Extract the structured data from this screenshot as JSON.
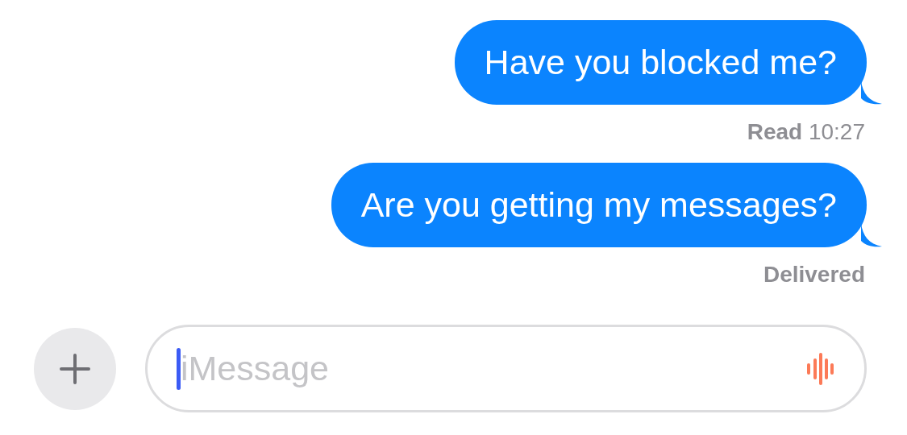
{
  "messages": [
    {
      "text": "Have you blocked me?",
      "receipt": {
        "status": "Read",
        "time": "10:27"
      }
    },
    {
      "text": "Are you getting my messages?",
      "receipt": {
        "status": "Delivered"
      }
    }
  ],
  "composer": {
    "placeholder": "iMessage",
    "focused": true
  }
}
